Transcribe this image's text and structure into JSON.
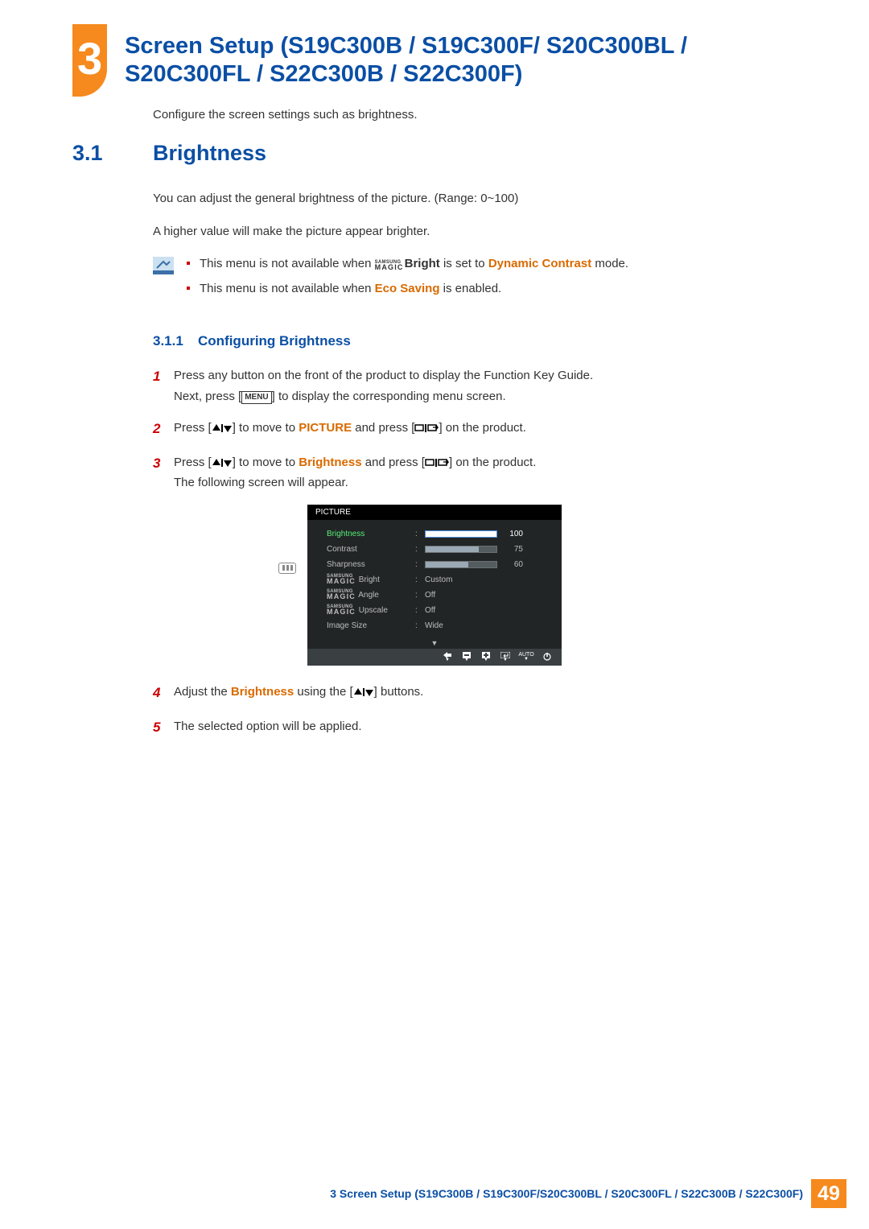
{
  "chapter": {
    "number": "3",
    "title": "Screen Setup (S19C300B / S19C300F/ S20C300BL / S20C300FL / S22C300B / S22C300F)"
  },
  "intro": "Configure the screen settings such as brightness.",
  "section": {
    "number": "3.1",
    "title": "Brightness",
    "p1": "You can adjust the general brightness of the picture. (Range: 0~100)",
    "p2": "A higher value will make the picture appear brighter."
  },
  "notes": {
    "line1_a": "This menu is not available when ",
    "line1_magic_brand": "SAMSUNG",
    "line1_magic_word": "MAGIC",
    "line1_bright": "Bright",
    "line1_b": " is set to ",
    "line1_mode": "Dynamic Contrast",
    "line1_c": " mode.",
    "line2_a": "This menu is not available when ",
    "line2_eco": "Eco Saving",
    "line2_b": " is enabled."
  },
  "subsection": {
    "number": "3.1.1",
    "title": "Configuring Brightness"
  },
  "steps": {
    "s1_a": "Press any button on the front of the product to display the Function Key Guide.",
    "s1_b_pre": "Next, press [",
    "s1_menu": "MENU",
    "s1_b_post": "] to display the corresponding menu screen.",
    "s2_a": "Press [",
    "s2_b": "] to move to ",
    "s2_pic": "PICTURE",
    "s2_c": " and press [",
    "s2_d": "] on the product.",
    "s3_a": "Press [",
    "s3_b": "] to move to ",
    "s3_bright": "Brightness",
    "s3_c": " and press [",
    "s3_d": "] on the product.",
    "s3_e": "The following screen will appear.",
    "s4_a": "Adjust the ",
    "s4_bright": "Brightness",
    "s4_b": " using the [",
    "s4_c": "] buttons.",
    "s5": "The selected option will be applied."
  },
  "osd": {
    "title": "PICTURE",
    "rows": [
      {
        "label": "Brightness",
        "type": "bar",
        "value": 100,
        "pct": 100,
        "active": true
      },
      {
        "label": "Contrast",
        "type": "bar",
        "value": 75,
        "pct": 75,
        "active": false
      },
      {
        "label": "Sharpness",
        "type": "bar",
        "value": 60,
        "pct": 60,
        "active": false
      },
      {
        "label": "Bright",
        "type": "magic",
        "value": "Custom"
      },
      {
        "label": "Angle",
        "type": "magic",
        "value": "Off"
      },
      {
        "label": "Upscale",
        "type": "magic",
        "value": "Off"
      },
      {
        "label": "Image Size",
        "type": "text",
        "value": "Wide"
      }
    ],
    "auto_label": "AUTO",
    "magic_brand": "SAMSUNG",
    "magic_word": "MAGIC"
  },
  "footer": {
    "text": "3 Screen Setup (S19C300B / S19C300F/S20C300BL / S20C300FL / S22C300B / S22C300F)",
    "page": "49"
  }
}
